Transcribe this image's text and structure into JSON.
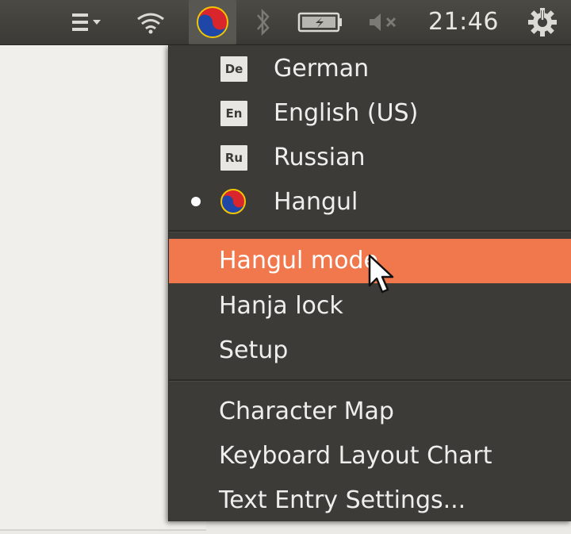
{
  "panel": {
    "clock": "21:46",
    "indicators": [
      {
        "icon": "menu-icon"
      },
      {
        "icon": "wifi-icon"
      },
      {
        "icon": "hangul-ibus-icon"
      },
      {
        "icon": "bluetooth-icon"
      },
      {
        "icon": "battery-charging-icon"
      },
      {
        "icon": "volume-muted-icon"
      },
      {
        "icon": "gear-icon"
      }
    ]
  },
  "menu": {
    "languages": [
      {
        "badge": "De",
        "label": "German"
      },
      {
        "badge": "En",
        "label": "English (US)"
      },
      {
        "badge": "Ru",
        "label": "Russian"
      },
      {
        "icon": "hangul-taegeuk-icon",
        "label": "Hangul",
        "selected": true
      }
    ],
    "engine_actions": [
      {
        "label": "Hangul mode",
        "highlighted": true
      },
      {
        "label": "Hanja lock"
      },
      {
        "label": "Setup"
      }
    ],
    "tools": [
      {
        "label": "Character Map"
      },
      {
        "label": "Keyboard Layout Chart"
      },
      {
        "label": "Text Entry Settings..."
      }
    ]
  },
  "colors": {
    "panel_bg": "#3c3b37",
    "menu_bg": "#3c3b37",
    "highlight": "#f0784c",
    "menu_text": "#eeeeec"
  }
}
